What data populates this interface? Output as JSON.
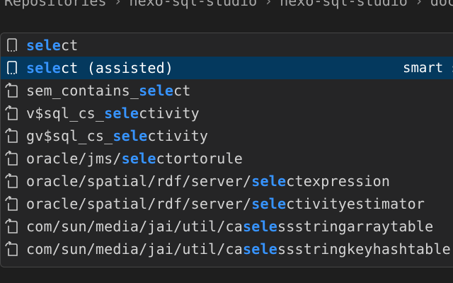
{
  "breadcrumb": {
    "items": [
      "Repositories",
      "nexo-sql-studio",
      "nexo-sql-studio",
      "doc"
    ]
  },
  "suggestions": [
    {
      "prefix": "",
      "match": "sele",
      "suffix": "ct",
      "icon": "snippet-icon",
      "detail": ""
    },
    {
      "prefix": "",
      "match": "sele",
      "suffix": "ct (assisted)",
      "icon": "snippet-icon",
      "detail": "smart s"
    },
    {
      "prefix": "sem_contains_",
      "match": "sele",
      "suffix": "ct",
      "icon": "reference-icon",
      "detail": ""
    },
    {
      "prefix": "v$sql_cs_",
      "match": "sele",
      "suffix": "ctivity",
      "icon": "reference-icon",
      "detail": ""
    },
    {
      "prefix": "gv$sql_cs_",
      "match": "sele",
      "suffix": "ctivity",
      "icon": "reference-icon",
      "detail": ""
    },
    {
      "prefix": "oracle/jms/",
      "match": "sele",
      "suffix": "ctortorule",
      "icon": "reference-icon",
      "detail": ""
    },
    {
      "prefix": "oracle/spatial/rdf/server/",
      "match": "sele",
      "suffix": "ctexpression",
      "icon": "reference-icon",
      "detail": ""
    },
    {
      "prefix": "oracle/spatial/rdf/server/",
      "match": "sele",
      "suffix": "ctivityestimator",
      "icon": "reference-icon",
      "detail": ""
    },
    {
      "prefix": "com/sun/media/jai/util/ca",
      "match": "sele",
      "suffix": "ssstringarraytable",
      "icon": "reference-icon",
      "detail": ""
    },
    {
      "prefix": "com/sun/media/jai/util/ca",
      "match": "sele",
      "suffix": "ssstringkeyhashtable",
      "icon": "reference-icon",
      "detail": ""
    }
  ],
  "selected_index": 1,
  "colors": {
    "background": "#1e1e1e",
    "panel": "#252526",
    "selected": "#04395e",
    "highlight": "#3794ff"
  }
}
